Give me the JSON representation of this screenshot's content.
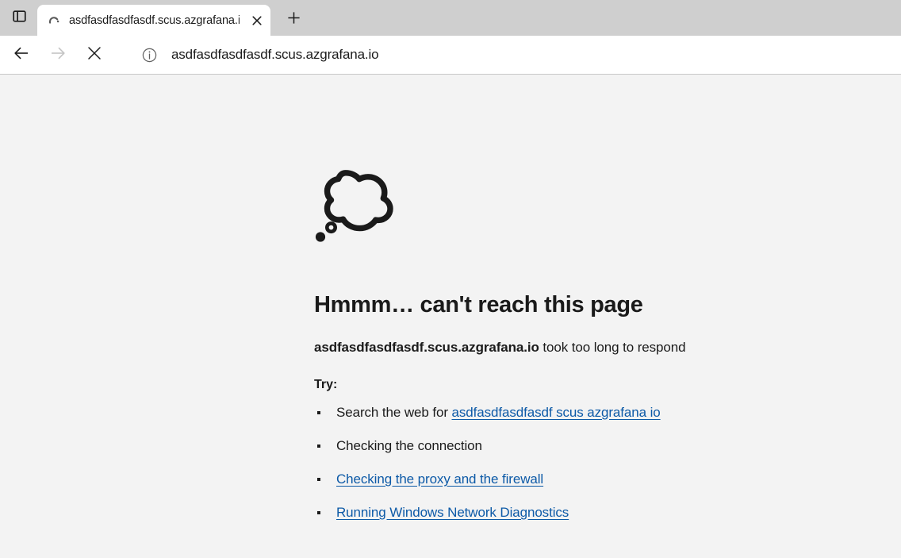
{
  "browser": {
    "tab_actions_icon": "vertical-tabs-icon",
    "tab": {
      "favicon": "loading-spinner-icon",
      "title": "asdfasdfasdfasdf.scus.azgrafana.i",
      "close_icon": "close-icon"
    },
    "new_tab_icon": "plus-icon",
    "nav": {
      "back_icon": "arrow-left-icon",
      "forward_icon": "arrow-right-icon",
      "stop_icon": "close-icon"
    },
    "omnibox": {
      "info_icon": "info-circle-icon",
      "url": "asdfasdfasdfasdf.scus.azgrafana.io"
    }
  },
  "page": {
    "illustration": "thought-bubble-icon",
    "title": "Hmmm… can't reach this page",
    "subtitle_host": "asdfasdfasdfasdf.scus.azgrafana.io",
    "subtitle_rest": " took too long to respond",
    "try_label": "Try:",
    "items": [
      {
        "prefix": "Search the web for ",
        "link": "asdfasdfasdfasdf scus azgrafana io",
        "suffix": "",
        "is_link": true
      },
      {
        "prefix": "Checking the connection",
        "link": "",
        "suffix": "",
        "is_link": false
      },
      {
        "prefix": "",
        "link": "Checking the proxy and the firewall",
        "suffix": "",
        "is_link": true
      },
      {
        "prefix": "",
        "link": "Running Windows Network Diagnostics",
        "suffix": "",
        "is_link": true
      }
    ]
  },
  "colors": {
    "link": "#0d5aa7",
    "page_bg": "#f3f3f3",
    "tabstrip_bg": "#cfcfcf",
    "toolbar_bg": "#ffffff",
    "text": "#1b1b1b"
  }
}
